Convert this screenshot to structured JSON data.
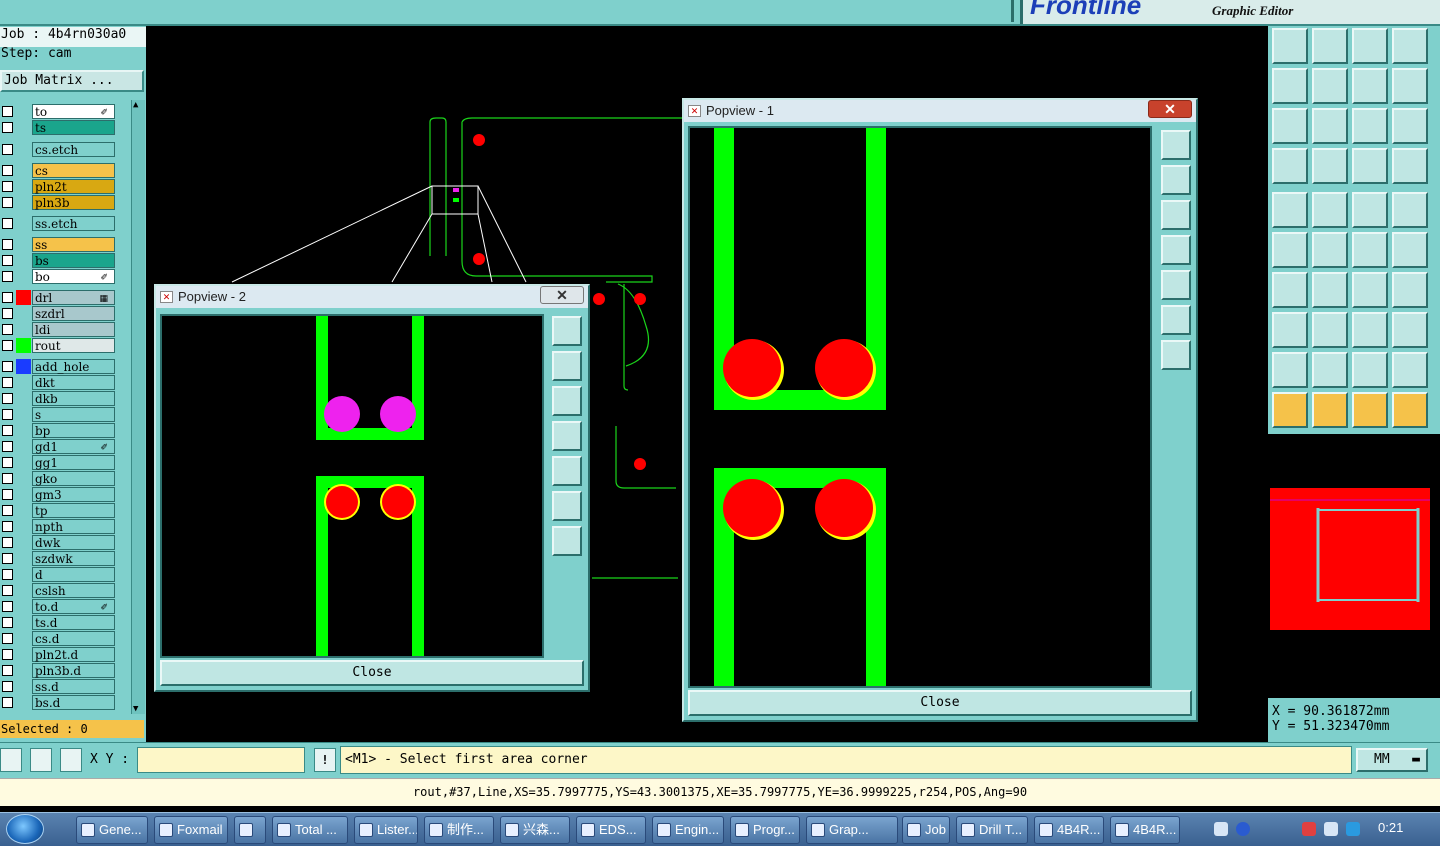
{
  "brand": {
    "logo_text": "Frontline",
    "subtitle": "Graphic Editor"
  },
  "job": {
    "job_label": "Job : 4b4rn030a0",
    "step_label": "Step: cam",
    "matrix_button": "Job Matrix ..."
  },
  "layers": [
    {
      "name": "to",
      "color": "#ffffff",
      "swatch": "",
      "icon": "✐"
    },
    {
      "name": "ts",
      "color": "#1aa58c",
      "swatch": "",
      "icon": ""
    },
    {
      "name": "cs.etch",
      "color": "#7fd0cc",
      "swatch": "",
      "icon": ""
    },
    {
      "name": "cs",
      "color": "#f5c24a",
      "swatch": "",
      "icon": ""
    },
    {
      "name": "pln2t",
      "color": "#d8a812",
      "swatch": "",
      "icon": ""
    },
    {
      "name": "pln3b",
      "color": "#d8a812",
      "swatch": "",
      "icon": ""
    },
    {
      "name": "ss.etch",
      "color": "#7fd0cc",
      "swatch": "",
      "icon": ""
    },
    {
      "name": "ss",
      "color": "#f5c24a",
      "swatch": "",
      "icon": ""
    },
    {
      "name": "bs",
      "color": "#1aa58c",
      "swatch": "",
      "icon": ""
    },
    {
      "name": "bo",
      "color": "#ffffff",
      "swatch": "",
      "icon": "✐"
    },
    {
      "name": "drl",
      "color": "#a8c8cc",
      "swatch": "#ff0000",
      "icon": "▦"
    },
    {
      "name": "szdrl",
      "color": "#a8c8cc",
      "swatch": "",
      "icon": ""
    },
    {
      "name": "ldi",
      "color": "#a8c8cc",
      "swatch": "",
      "icon": ""
    },
    {
      "name": "rout",
      "color": "#dfe8e8",
      "swatch": "#00ff00",
      "icon": ""
    },
    {
      "name": "add_hole",
      "color": "#7fd0cc",
      "swatch": "#1a3cff",
      "icon": ""
    },
    {
      "name": "dkt",
      "color": "#7fd0cc",
      "swatch": "",
      "icon": ""
    },
    {
      "name": "dkb",
      "color": "#7fd0cc",
      "swatch": "",
      "icon": ""
    },
    {
      "name": "s",
      "color": "#7fd0cc",
      "swatch": "",
      "icon": ""
    },
    {
      "name": "bp",
      "color": "#7fd0cc",
      "swatch": "",
      "icon": ""
    },
    {
      "name": "gd1",
      "color": "#7fd0cc",
      "swatch": "",
      "icon": "✐"
    },
    {
      "name": "gg1",
      "color": "#7fd0cc",
      "swatch": "",
      "icon": ""
    },
    {
      "name": "gko",
      "color": "#7fd0cc",
      "swatch": "",
      "icon": ""
    },
    {
      "name": "gm3",
      "color": "#7fd0cc",
      "swatch": "",
      "icon": ""
    },
    {
      "name": "tp",
      "color": "#7fd0cc",
      "swatch": "",
      "icon": ""
    },
    {
      "name": "npth",
      "color": "#7fd0cc",
      "swatch": "",
      "icon": ""
    },
    {
      "name": "dwk",
      "color": "#7fd0cc",
      "swatch": "",
      "icon": ""
    },
    {
      "name": "szdwk",
      "color": "#7fd0cc",
      "swatch": "",
      "icon": ""
    },
    {
      "name": "d",
      "color": "#7fd0cc",
      "swatch": "",
      "icon": ""
    },
    {
      "name": "cslsh",
      "color": "#7fd0cc",
      "swatch": "",
      "icon": ""
    },
    {
      "name": "to.d",
      "color": "#7fd0cc",
      "swatch": "",
      "icon": "✐"
    },
    {
      "name": "ts.d",
      "color": "#7fd0cc",
      "swatch": "",
      "icon": ""
    },
    {
      "name": "cs.d",
      "color": "#7fd0cc",
      "swatch": "",
      "icon": ""
    },
    {
      "name": "pln2t.d",
      "color": "#7fd0cc",
      "swatch": "",
      "icon": ""
    },
    {
      "name": "pln3b.d",
      "color": "#7fd0cc",
      "swatch": "",
      "icon": ""
    },
    {
      "name": "ss.d",
      "color": "#7fd0cc",
      "swatch": "",
      "icon": ""
    },
    {
      "name": "bs.d",
      "color": "#7fd0cc",
      "swatch": "",
      "icon": ""
    }
  ],
  "selected_label": "Selected : 0",
  "popview1": {
    "title": "Popview - 1",
    "close_label": "Close"
  },
  "popview2": {
    "title": "Popview - 2",
    "close_label": "Close"
  },
  "coords": {
    "x": "X = 90.361872mm",
    "y": "Y = 51.323470mm"
  },
  "cmd": {
    "xy_label": "X Y :",
    "prompt": "<M1> - Select first area corner",
    "unit": "MM"
  },
  "status": "rout,#37,Line,XS=35.7997775,YS=43.3001375,XE=35.7997775,YE=36.9999225,r254,POS,Ang=90",
  "taskbar": {
    "items": [
      "Gene...",
      "Foxmail",
      "",
      "Total ...",
      "Lister...",
      "制作...",
      "兴森...",
      "EDS...",
      "Engin...",
      "Progr...",
      "Grap...",
      "Job ...",
      "Drill T...",
      "4B4R...",
      "4B4R..."
    ],
    "clock": "0:21"
  },
  "colors": {
    "rout_green": "#00ff00",
    "pad_red": "#ff0000",
    "pad_yellow": "#ffff00",
    "pad_magenta": "#ee22ee",
    "ui_teal": "#7fd0cc"
  }
}
